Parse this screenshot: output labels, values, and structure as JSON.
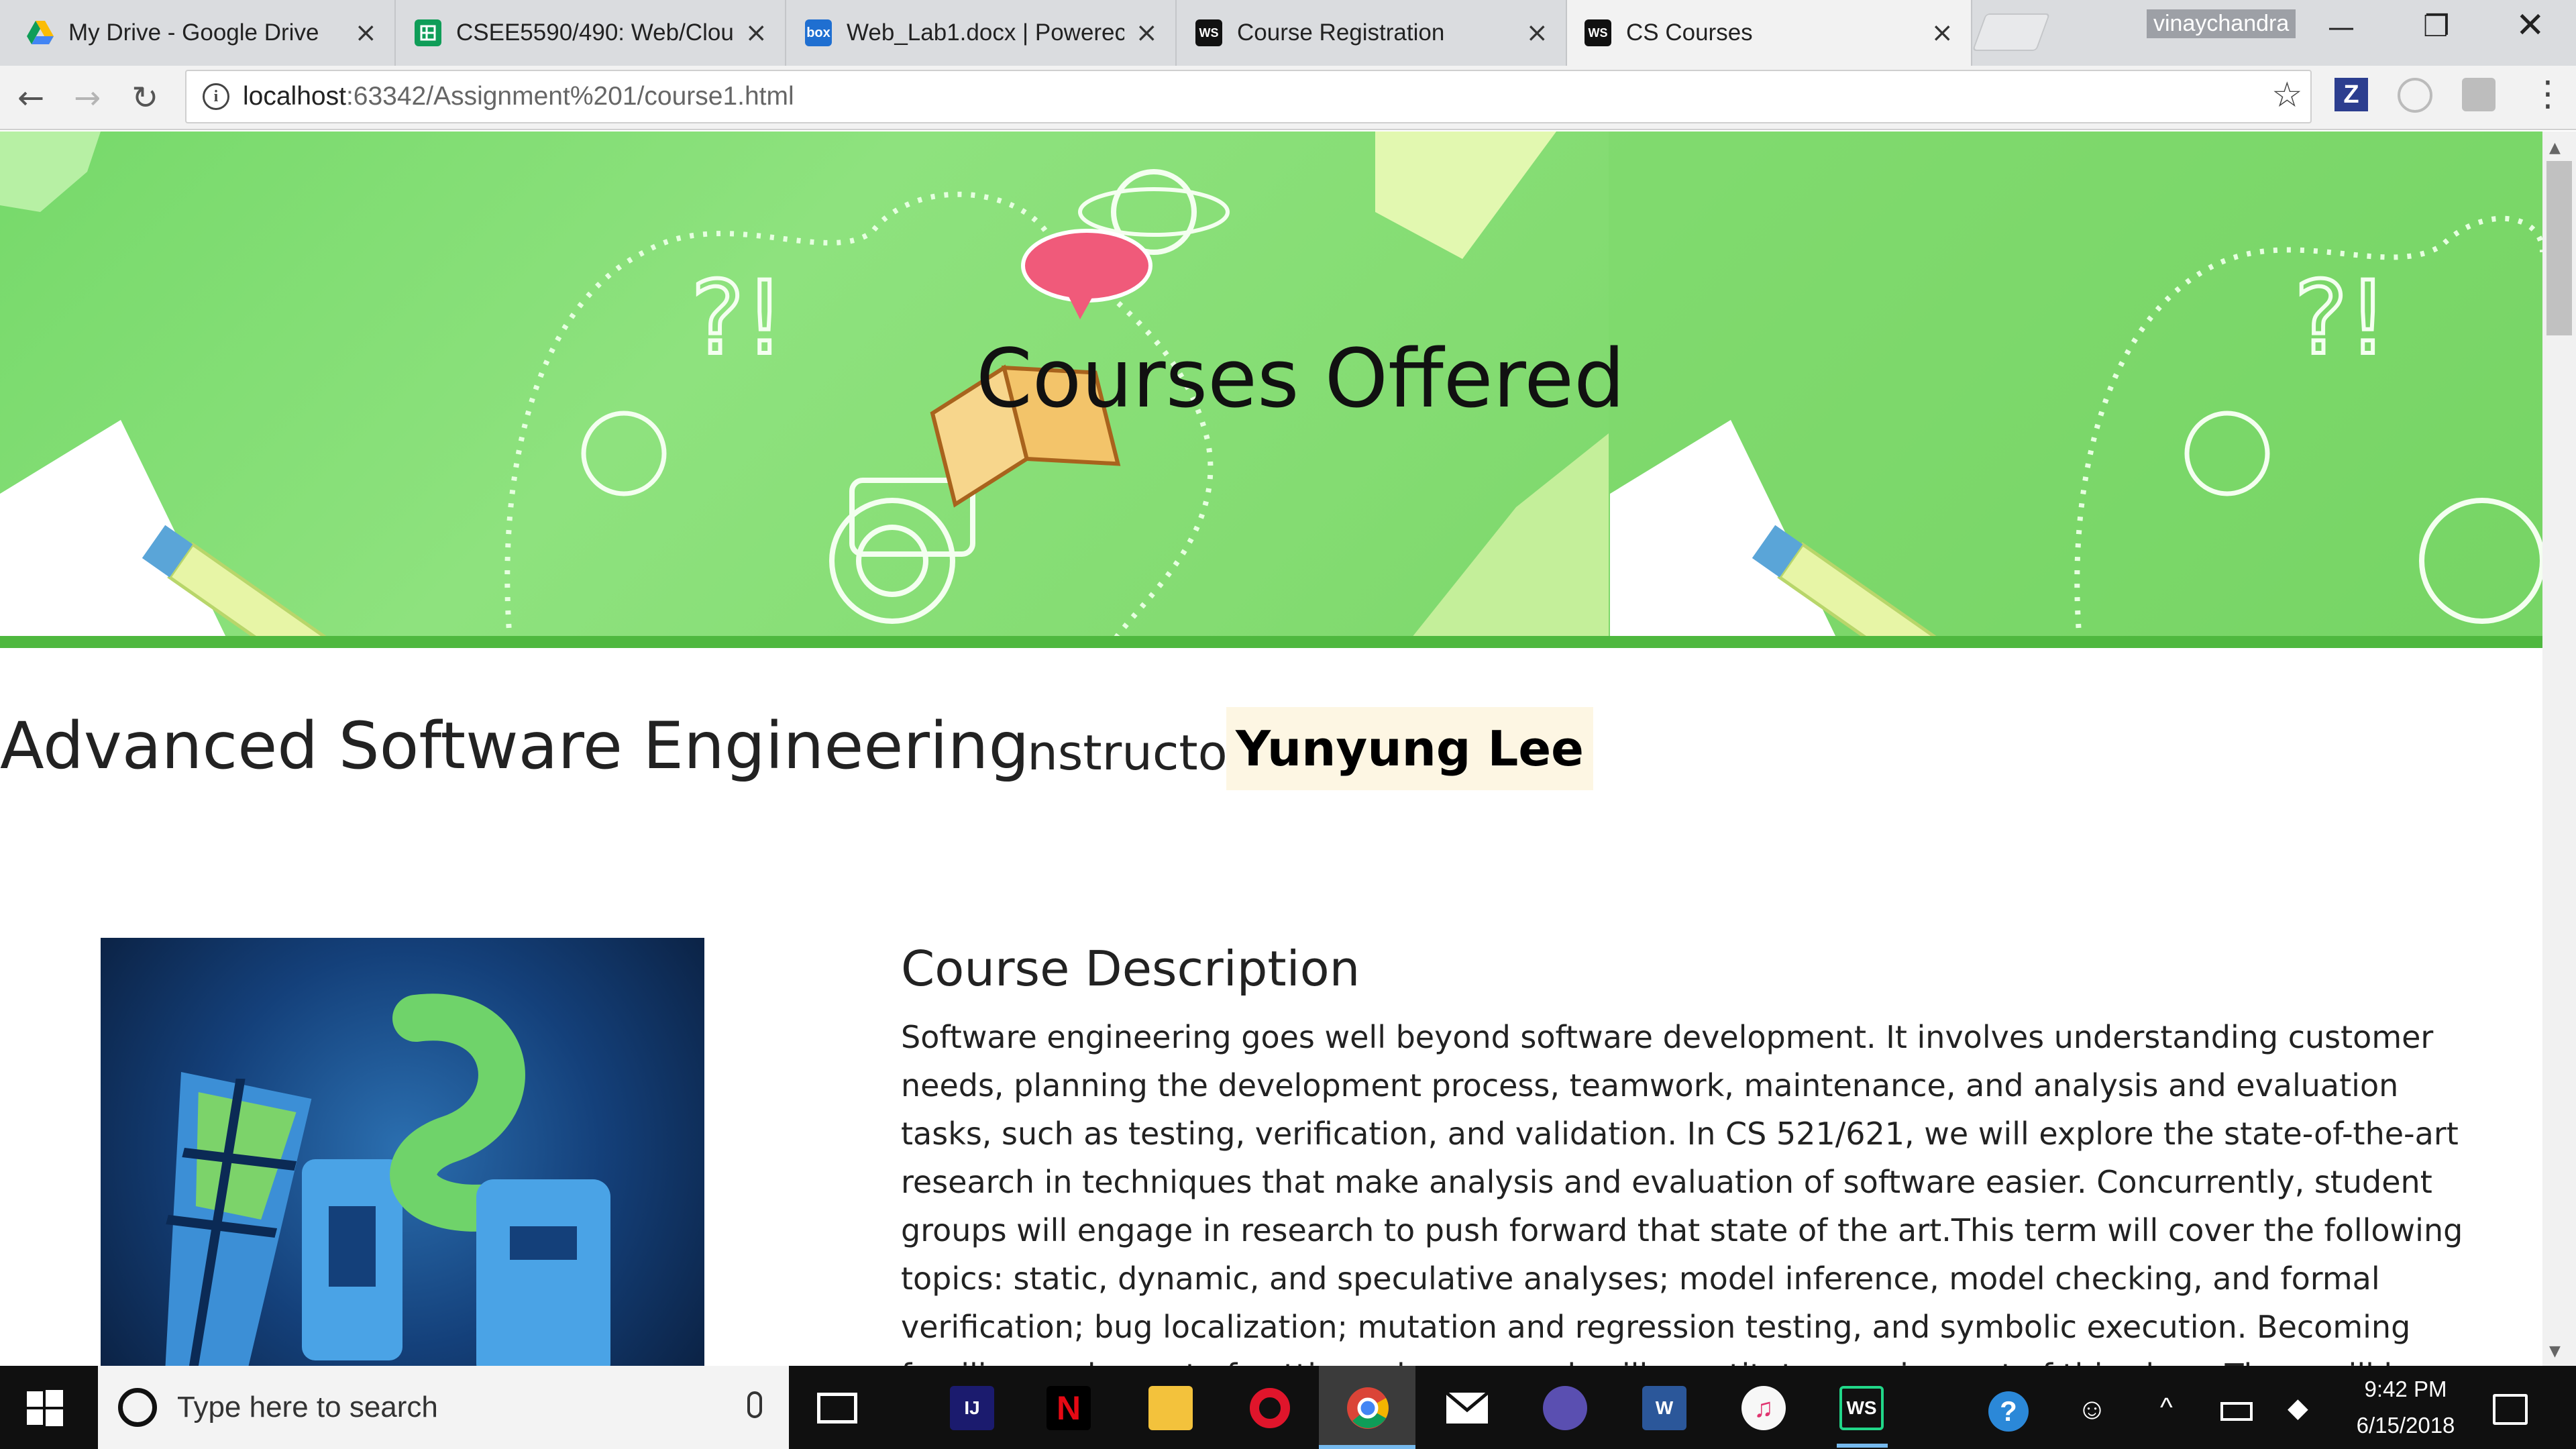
{
  "browser": {
    "tabs": [
      {
        "title": "My Drive - Google Drive",
        "icon": "google-drive-icon"
      },
      {
        "title": "CSEE5590/490: Web/Clou",
        "icon": "google-sheets-icon"
      },
      {
        "title": "Web_Lab1.docx | Powerec",
        "icon": "box-icon",
        "icon_text": "box"
      },
      {
        "title": "Course Registration",
        "icon": "webstorm-icon",
        "icon_text": "WS"
      },
      {
        "title": "CS Courses",
        "icon": "webstorm-icon",
        "icon_text": "WS",
        "active": true
      }
    ],
    "profile_name": "vinaychandra",
    "url_host": "localhost",
    "url_path": ":63342/Assignment%201/course1.html",
    "extension_z_label": "Z"
  },
  "page": {
    "banner_title": "Courses Offered",
    "course_name": "Advanced Software Engineering",
    "instructor_label": "Instructor:",
    "instructor_name": "Yunyung Lee",
    "description_heading": "Course Description",
    "description_text": "Software engineering goes well beyond software development. It involves understanding customer needs, planning the development process, teamwork, maintenance, and analysis and evaluation tasks, such as testing, verification, and validation. In CS 521/621, we will explore the state-of-the-art research in techniques that make analysis and evaluation of software easier. Concurrently, student groups will engage in research to push forward that state of the art.This term will cover the following topics: static, dynamic, and speculative analyses; model inference, model checking, and formal verification; bug localization; mutation and regression testing, and symbolic execution. Becoming familiar, and a part of cutting-edge research will constitute a major part of this class. There will be three research aspects of the class. The lectures and"
  },
  "taskbar": {
    "search_placeholder": "Type here to search",
    "time": "9:42 PM",
    "date": "6/15/2018"
  }
}
